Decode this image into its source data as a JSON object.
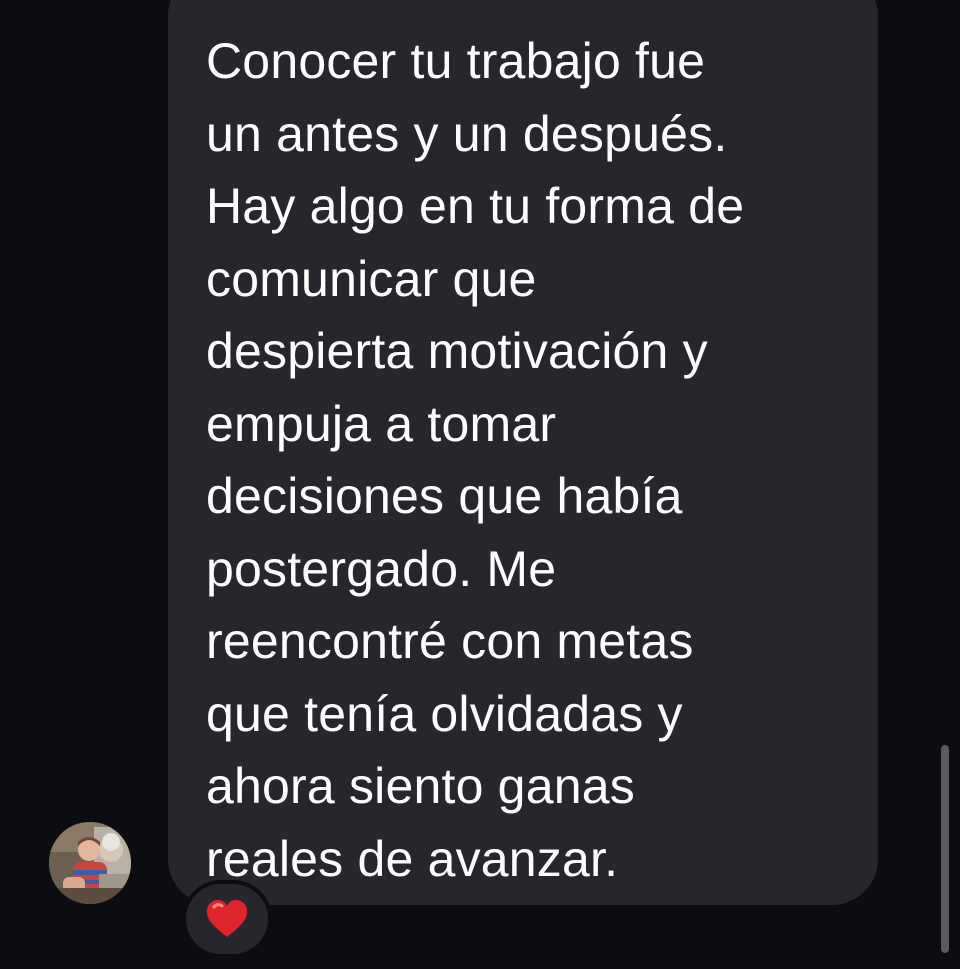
{
  "message": {
    "text": "Conocer tu trabajo fue\nun antes y un después.\nHay algo en tu forma de\ncomunicar que\ndespierta motivación y\nempuja a tomar\ndecisiones que había\npostergado. Me\nreencontré con metas\nque tenía olvidadas y\nahora siento ganas\nreales de avanzar."
  },
  "reaction": {
    "icon": "red-heart-icon",
    "color": "#e0242b"
  },
  "avatar": {
    "icon": "user-photo-avatar"
  },
  "colors": {
    "background": "#0c0d10",
    "bubble": "#26272c",
    "text": "#ffffff"
  }
}
